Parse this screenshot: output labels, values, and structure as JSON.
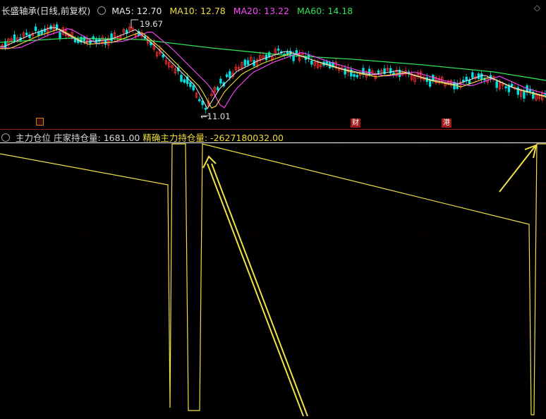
{
  "header": {
    "stock_name": "长盛轴承",
    "chart_mode": "(日线,前复权)",
    "ma5_label": "MA5:",
    "ma5_value": "12.70",
    "ma10_label": "MA10:",
    "ma10_value": "12.78",
    "ma20_label": "MA20:",
    "ma20_value": "13.22",
    "ma60_label": "MA60:",
    "ma60_value": "14.18"
  },
  "price_chart": {
    "high_label": "19.67",
    "low_label": "11.01",
    "event_tags": [
      "财",
      "港"
    ],
    "colors": {
      "up": "#ff3030",
      "down": "#00e0e0",
      "ma5": "#e8e8e8",
      "ma10": "#f2dd3a",
      "ma20": "#ff47ff",
      "ma60": "#2fe25a"
    }
  },
  "indicator": {
    "title": "主力仓位",
    "holding_label": "庄家持仓量:",
    "holding_value": "1681.00",
    "precise_label": "精确主力持仓量:",
    "precise_value": "-2627180032.00",
    "line_color": "#f2e04a"
  }
}
